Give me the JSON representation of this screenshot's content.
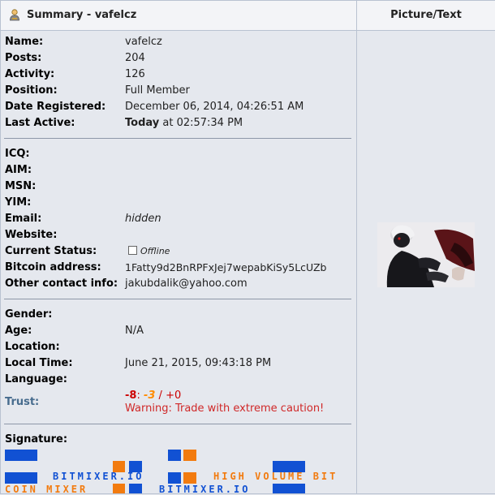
{
  "header": {
    "summary_title": "Summary - vafelcz",
    "picture_title": "Picture/Text"
  },
  "profile": {
    "name_label": "Name:",
    "name": "vafelcz",
    "posts_label": "Posts:",
    "posts": "204",
    "activity_label": "Activity:",
    "activity": "126",
    "position_label": "Position:",
    "position": "Full Member",
    "registered_label": "Date Registered:",
    "registered": "December 06, 2014, 04:26:51 AM",
    "last_active_label": "Last Active:",
    "last_active_bold": "Today",
    "last_active_rest": " at 02:57:34 PM"
  },
  "contact": {
    "icq_label": "ICQ:",
    "aim_label": "AIM:",
    "msn_label": "MSN:",
    "yim_label": "YIM:",
    "email_label": "Email:",
    "email": "hidden",
    "website_label": "Website:",
    "status_label": "Current Status:",
    "status": "Offline",
    "bitcoin_label": "Bitcoin address:",
    "bitcoin": "1Fatty9d2BnRPFxJej7wepabKiSy5LcUZb",
    "other_label": "Other contact info:",
    "other": "jakubdalik@yahoo.com"
  },
  "personal": {
    "gender_label": "Gender:",
    "age_label": "Age:",
    "age": "N/A",
    "location_label": "Location:",
    "local_time_label": "Local Time:",
    "local_time": "June 21, 2015, 09:43:18 PM",
    "language_label": "Language:",
    "trust_label": "Trust:",
    "trust_neg": "-8",
    "trust_sep1": ": ",
    "trust_mid": "-3",
    "trust_sep2": " / ",
    "trust_pos": "+0",
    "trust_warning": "Warning: Trade with extreme caution!"
  },
  "signature": {
    "label": "Signature:",
    "text1": "BITMIXER.IO",
    "text2": "HIGH VOLUME BIT",
    "text3": "COIN MIXER",
    "text4": "BITMIXER.IO"
  },
  "colors": {
    "accent_blue": "#1151d3",
    "accent_orange": "#f27b0f",
    "warning": "#d02828"
  }
}
